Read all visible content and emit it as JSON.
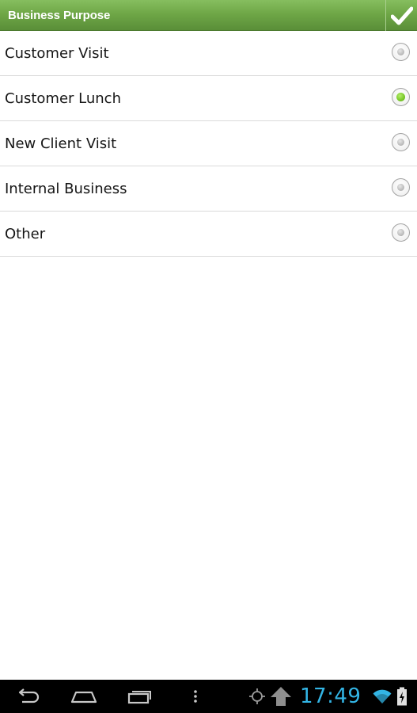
{
  "header": {
    "title": "Business Purpose",
    "confirm_icon": "checkmark-icon"
  },
  "options": [
    {
      "label": "Customer Visit",
      "selected": false
    },
    {
      "label": "Customer Lunch",
      "selected": true
    },
    {
      "label": "New Client Visit",
      "selected": false
    },
    {
      "label": "Internal Business",
      "selected": false
    },
    {
      "label": "Other",
      "selected": false
    }
  ],
  "system_bar": {
    "time": "17:49",
    "icons": [
      "back-icon",
      "home-icon",
      "recent-apps-icon",
      "menu-icon",
      "gps-icon",
      "upload-icon",
      "wifi-icon",
      "battery-charging-icon"
    ]
  },
  "colors": {
    "header_green": "#6fa747",
    "selected_green": "#7ccb2c",
    "clock_blue": "#33b5e5"
  }
}
